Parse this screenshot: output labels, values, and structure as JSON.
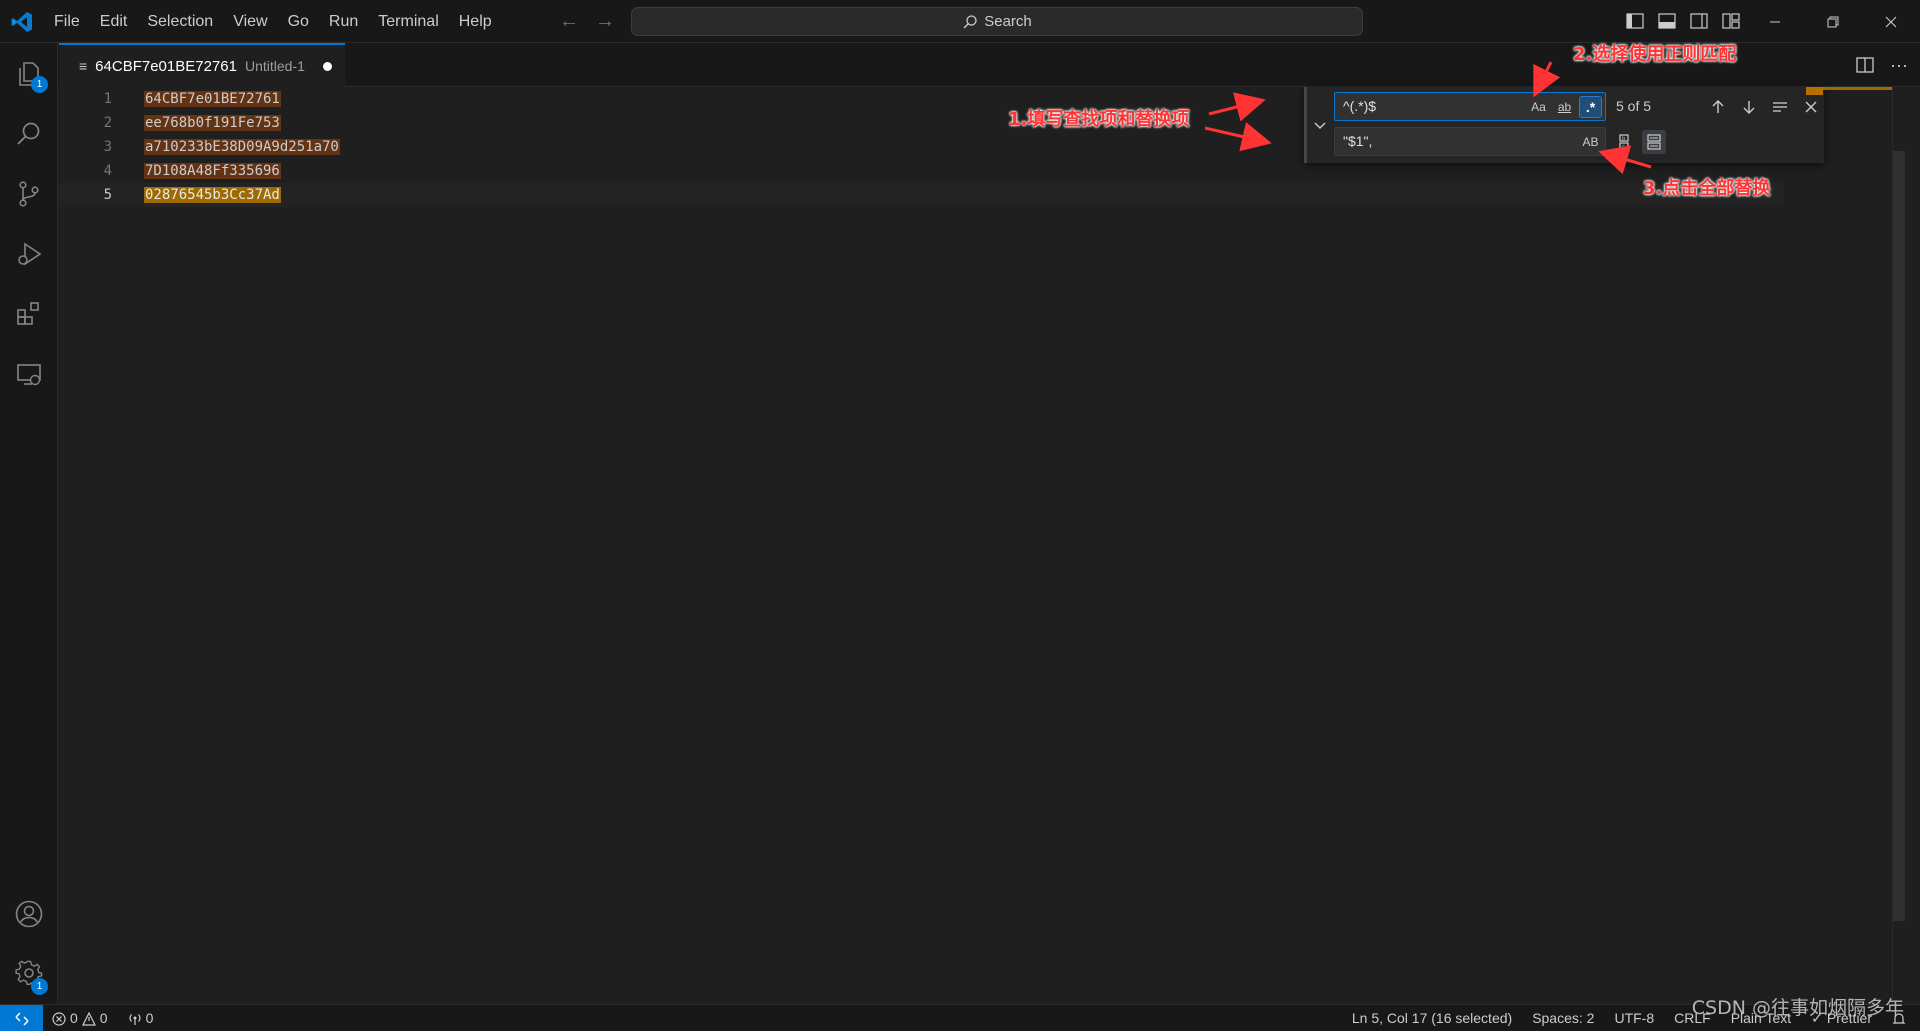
{
  "menu": [
    "File",
    "Edit",
    "Selection",
    "View",
    "Go",
    "Run",
    "Terminal",
    "Help"
  ],
  "command_center": {
    "label": "Search"
  },
  "activity": {
    "explorer_badge": "1",
    "settings_badge": "1"
  },
  "tab": {
    "name": "64CBF7e01BE72761",
    "description": "Untitled-1"
  },
  "editor": {
    "line_numbers": [
      "1",
      "2",
      "3",
      "4",
      "5"
    ],
    "lines": [
      "64CBF7e01BE72761",
      "ee768b0f191Fe753",
      "a710233bE38D09A9d251a70",
      "7D108A48Ff335696",
      "02876545b3Cc37Ad"
    ]
  },
  "find": {
    "find_value": "^(.*)$",
    "replace_value": "\"$1\",",
    "match_case_label": "Aa",
    "whole_word_label": "ab",
    "regex_label": ".*",
    "preserve_case_label": "AB",
    "match_count": "5 of 5"
  },
  "annotations": {
    "step1": "1.填写查找项和替换项",
    "step2": "2.选择使用正则匹配",
    "step3": "3.点击全部替换",
    "color": "#ff3333"
  },
  "status": {
    "errors": "0",
    "warnings": "0",
    "ports": "0",
    "cursor": "Ln 5, Col 17 (16 selected)",
    "spaces": "Spaces: 2",
    "encoding": "UTF-8",
    "eol": "CRLF",
    "language": "Plain Text",
    "prettier": "Prettier"
  },
  "watermark": "CSDN @往事如烟隔多年",
  "colors": {
    "accent": "#0078d4",
    "match_highlight": "#623315",
    "current_match": "#9e6a03"
  }
}
